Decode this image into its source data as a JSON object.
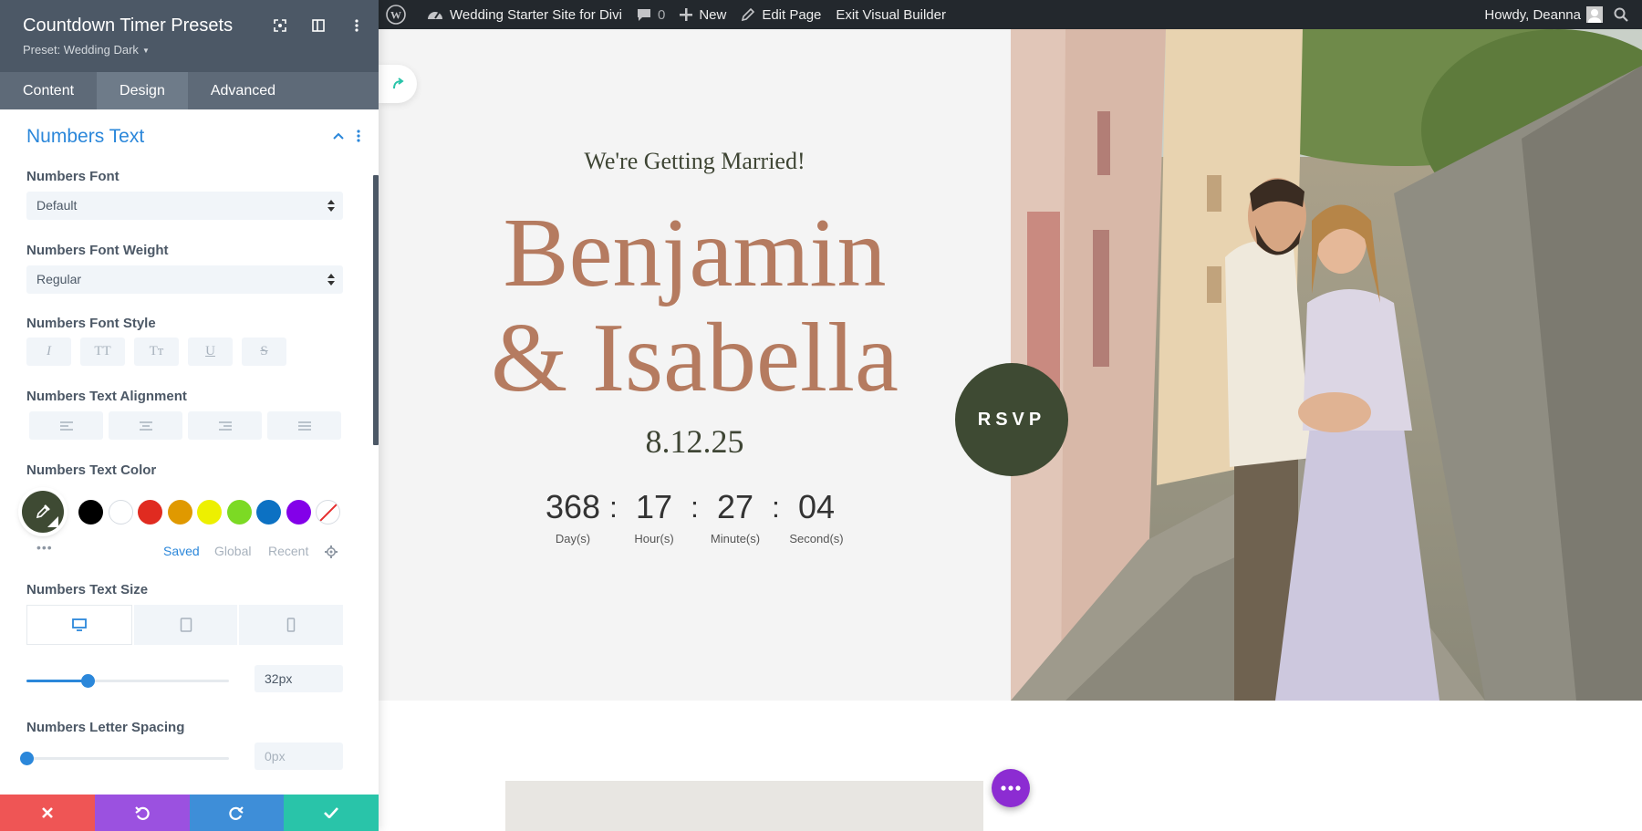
{
  "admin_bar": {
    "site_name": "Wedding Starter Site for Divi",
    "comments_count": "0",
    "new_label": "New",
    "edit_label": "Edit Page",
    "exit_label": "Exit Visual Builder",
    "greeting": "Howdy, Deanna"
  },
  "panel": {
    "title": "Countdown Timer Presets",
    "preset": "Preset: Wedding Dark",
    "tabs": [
      "Content",
      "Design",
      "Advanced"
    ],
    "active_tab": "Design",
    "section_title": "Numbers Text",
    "fields": {
      "font_label": "Numbers Font",
      "font_value": "Default",
      "weight_label": "Numbers Font Weight",
      "weight_value": "Regular",
      "style_label": "Numbers Font Style",
      "style_buttons": [
        "I",
        "TT",
        "Tт",
        "U",
        "S"
      ],
      "alignment_label": "Numbers Text Alignment",
      "color_label": "Numbers Text Color",
      "color_tabs": [
        "Saved",
        "Global",
        "Recent"
      ],
      "size_label": "Numbers Text Size",
      "size_value": "32px",
      "size_slider_level": 0.3,
      "spacing_label": "Numbers Letter Spacing",
      "spacing_value": "0px",
      "spacing_slider_level": 0.0
    },
    "swatches": [
      "#000000",
      "#ffffff",
      "#e02b20",
      "#e09900",
      "#edf000",
      "#7cda24",
      "#0c71c3",
      "#8300e9"
    ],
    "selected_color": "#3e4a33"
  },
  "hero": {
    "tagline": "We're Getting Married!",
    "name1": "Benjamin",
    "name2": "& Isabella",
    "date": "8.12.25",
    "countdown": [
      {
        "value": "368",
        "label": "Day(s)"
      },
      {
        "value": "17",
        "label": "Hour(s)"
      },
      {
        "value": "27",
        "label": "Minute(s)"
      },
      {
        "value": "04",
        "label": "Second(s)"
      }
    ],
    "rsvp_label": "RSVP"
  },
  "colors": {
    "accent_blue": "#2b87da",
    "panel_dark": "#4c5866",
    "name_copper": "#b57b60",
    "olive": "#3e4a33",
    "fab_purple": "#8c2cd2",
    "footer_buttons": [
      "#ef5555",
      "#9b51e0",
      "#3e8ed8",
      "#29c4a9"
    ]
  }
}
